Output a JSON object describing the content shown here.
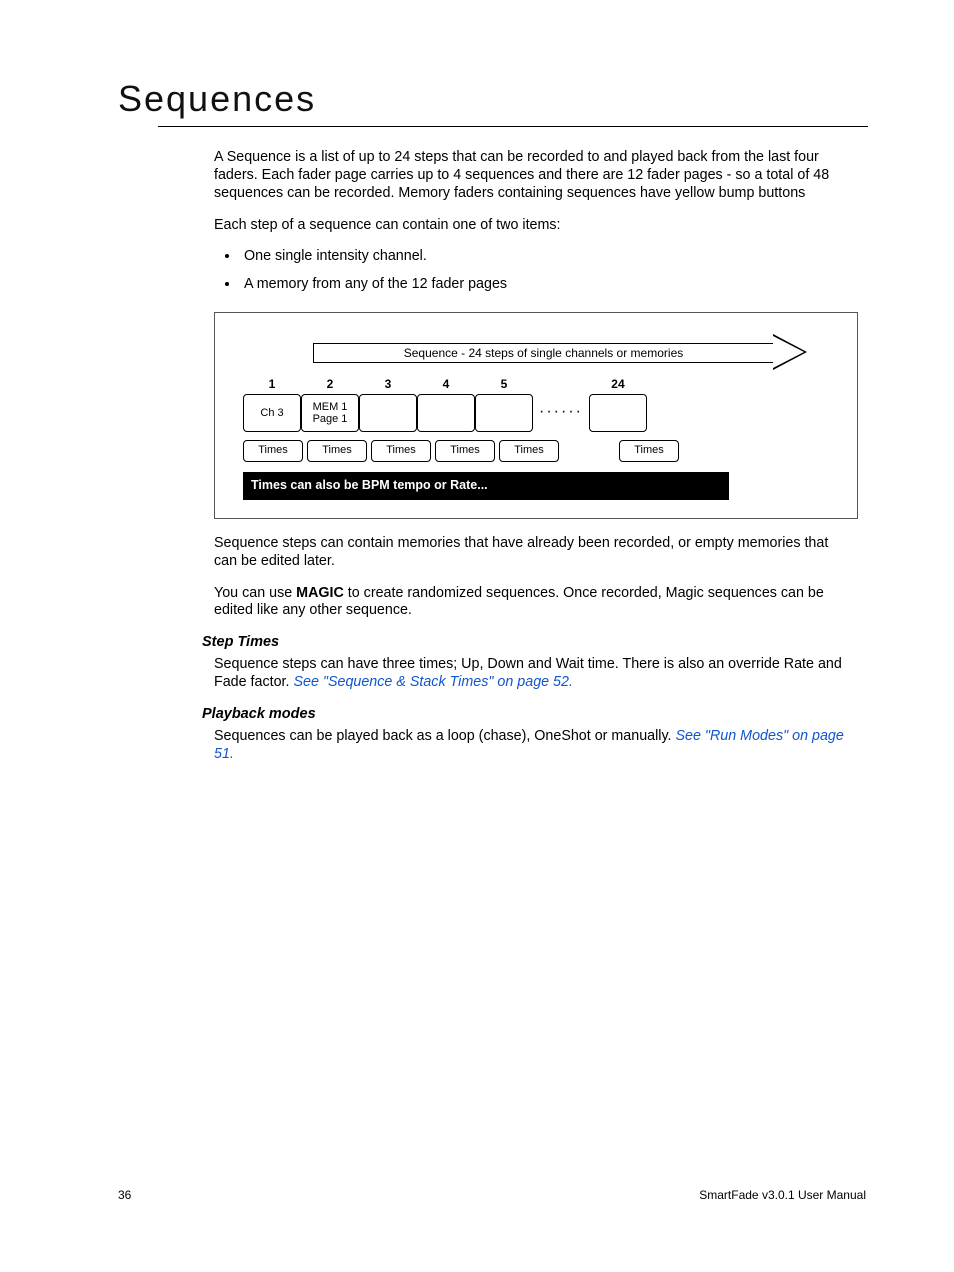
{
  "title": "Sequences",
  "para1": "A Sequence is a list of up to 24 steps that can be recorded to and played back from the last four faders. Each fader page carries up to 4 sequences and there are 12 fader pages - so a total of 48 sequences can be recorded. Memory faders containing sequences have yellow bump buttons",
  "para2": "Each step of a sequence can contain one of two items:",
  "bullets": {
    "b1": "One single intensity channel.",
    "b2": "A memory from any of the 12 fader pages"
  },
  "diagram": {
    "arrow_label": "Sequence - 24 steps of single channels or memories",
    "steps": {
      "n1": "1",
      "n2": "2",
      "n3": "3",
      "n4": "4",
      "n5": "5",
      "nlast": "24",
      "s1": "Ch 3",
      "s2a": "MEM 1",
      "s2b": "Page 1"
    },
    "times_label": "Times",
    "black_bar": "Times can also be BPM tempo or Rate..."
  },
  "para3": "Sequence steps can contain memories that have already been recorded, or empty memories that can be edited later.",
  "para4a": "You can use ",
  "para4b_bold": "MAGIC",
  "para4c": " to create randomized sequences. Once recorded, Magic sequences can be edited like any other sequence.",
  "step_times": {
    "heading": "Step Times",
    "text_a": "Sequence steps can have three times; Up, Down and Wait time. There is also an override Rate and Fade factor. ",
    "link": "See \"Sequence & Stack Times\" on page 52."
  },
  "playback_modes": {
    "heading": "Playback modes",
    "text_a": "Sequences can be played back as a loop (chase), OneShot or manually. ",
    "link": "See \"Run Modes\" on page 51."
  },
  "footer": {
    "page_num": "36",
    "doc": "SmartFade v3.0.1 User Manual"
  }
}
